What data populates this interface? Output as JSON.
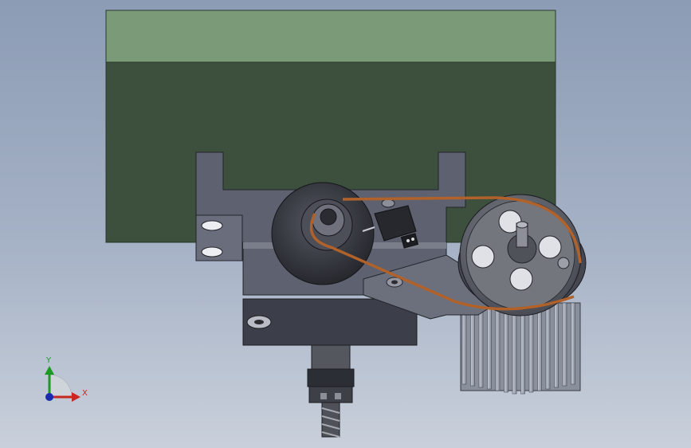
{
  "viewport": {
    "background_top": "#8c9cb5",
    "background_bottom": "#c9d0db"
  },
  "colors": {
    "green_light": "#7a9a78",
    "green_dark": "#3d4f3d",
    "metal": "#5d6170",
    "metal_dark": "#3c3f49",
    "belt": "#b0622a",
    "pulley": "#6b6d75"
  },
  "triad": {
    "y_label": "Y",
    "x_label": "X",
    "y_color": "#1a9a22",
    "x_color": "#c8281e",
    "z_color": "#1a2bb0"
  }
}
